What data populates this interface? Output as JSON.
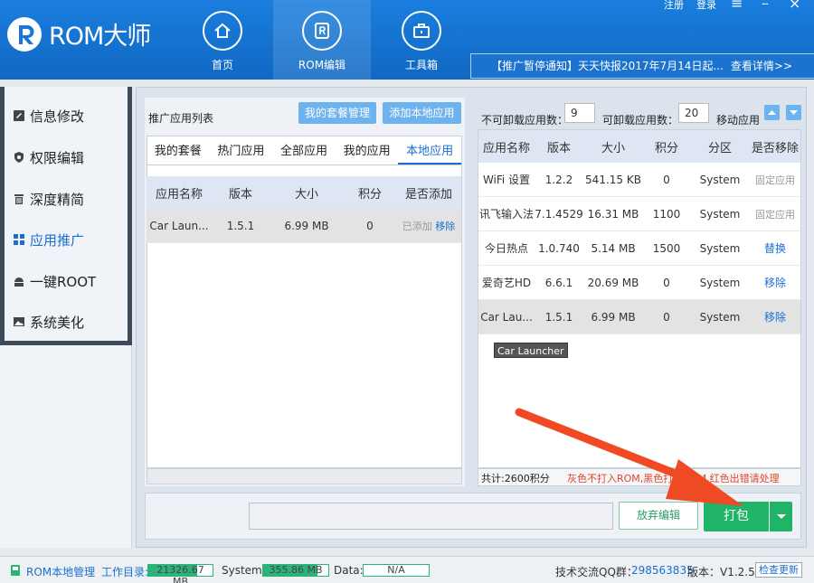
{
  "app": {
    "title": "ROM大师"
  },
  "topbar": {
    "register": "注册",
    "login": "登录"
  },
  "nav": [
    {
      "label": "首页",
      "icon": "home-icon"
    },
    {
      "label": "ROM编辑",
      "icon": "rom-edit-icon"
    },
    {
      "label": "工具箱",
      "icon": "toolbox-icon"
    }
  ],
  "notice": {
    "text": "【推广暂停通知】天天快报2017年7月14日起...",
    "link": "查看详情>>"
  },
  "sidebar": [
    {
      "label": "信息修改",
      "icon": "edit-icon"
    },
    {
      "label": "权限编辑",
      "icon": "shield-icon"
    },
    {
      "label": "深度精简",
      "icon": "trash-icon"
    },
    {
      "label": "应用推广",
      "icon": "grid-icon"
    },
    {
      "label": "一键ROOT",
      "icon": "android-icon"
    },
    {
      "label": "系统美化",
      "icon": "image-icon"
    }
  ],
  "left": {
    "title": "推广应用列表",
    "btn_package_manage": "我的套餐管理",
    "btn_add_local": "添加本地应用",
    "tabs": [
      "我的套餐",
      "热门应用",
      "全部应用",
      "我的应用",
      "本地应用"
    ],
    "columns": [
      "应用名称",
      "版本",
      "大小",
      "积分",
      "是否添加"
    ],
    "rows": [
      {
        "name": "Car Laun...",
        "version": "1.5.1",
        "size": "6.99 MB",
        "points": "0",
        "added": "已添加",
        "action": "移除"
      }
    ]
  },
  "right": {
    "non_uninstall_label": "不可卸载应用数：",
    "non_uninstall_value": "9",
    "uninstall_label": "可卸载应用数：",
    "uninstall_value": "20",
    "move_label": "移动应用",
    "columns": [
      "应用名称",
      "版本",
      "大小",
      "积分",
      "分区",
      "是否移除"
    ],
    "rows": [
      {
        "name": "WiFi 设置",
        "version": "1.2.2",
        "size": "541.15 KB",
        "points": "0",
        "partition": "System",
        "action": "固定应用"
      },
      {
        "name": "讯飞输入法",
        "version": "7.1.4529",
        "size": "16.31 MB",
        "points": "1100",
        "partition": "System",
        "action": "固定应用"
      },
      {
        "name": "今日热点",
        "version": "1.0.740",
        "size": "5.14 MB",
        "points": "1500",
        "partition": "System",
        "action": "替换"
      },
      {
        "name": "爱奇艺HD",
        "version": "6.6.1",
        "size": "20.69 MB",
        "points": "0",
        "partition": "System",
        "action": "移除"
      },
      {
        "name": "Car Lau...",
        "version": "1.5.1",
        "size": "6.99 MB",
        "points": "0",
        "partition": "System",
        "action": "移除"
      }
    ],
    "tooltip": "Car Launcher",
    "total": "共计:2600积分",
    "legend": "灰色不打入ROM,黑色打入ROM,红色出错请处理"
  },
  "actions": {
    "discard": "放弃编辑",
    "package": "打包"
  },
  "status": {
    "local_manage": "ROM本地管理",
    "work_dir_label": "工作目录:",
    "work_dir_value": "21326.67 MB",
    "system_label": "System:",
    "system_value": "355.86 MB",
    "data_label": "Data:",
    "data_value": "N/A",
    "qq_label": "技术交流QQ群：",
    "qq_value": "298563835",
    "version_label": "版本：V1.2.5",
    "check_update": "检查更新"
  },
  "colors": {
    "brand": "#1a6fd1",
    "package_btn": "#1fb468",
    "arrow": "#f04a24"
  }
}
